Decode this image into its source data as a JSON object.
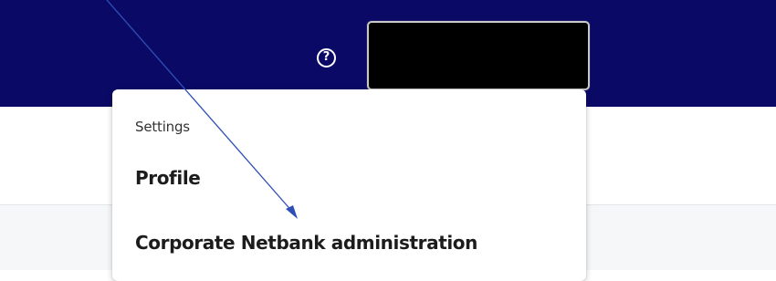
{
  "header": {
    "background_color": "#0a0a66",
    "help_icon": "question-circle-icon",
    "help_glyph": "?",
    "user_box_color": "#000000"
  },
  "menu": {
    "section_label": "Settings",
    "items": [
      {
        "label": "Profile"
      },
      {
        "label": "Corporate Netbank administration"
      }
    ]
  },
  "annotation": {
    "arrow_color": "#2e4fb5",
    "arrow_icon": "arrow-annotation-icon"
  }
}
